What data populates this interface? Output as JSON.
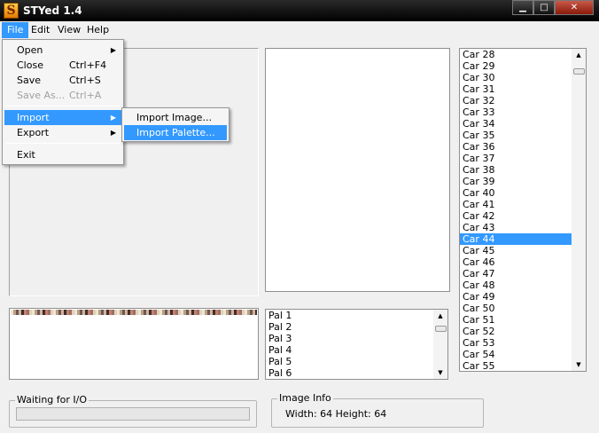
{
  "window": {
    "title": "STYed 1.4",
    "app_icon_letter": "S",
    "min_glyph": "▁",
    "max_glyph": "□",
    "close_glyph": "✕"
  },
  "menubar": [
    "File",
    "Edit",
    "View",
    "Help"
  ],
  "file_menu": {
    "items": [
      {
        "label": "Open",
        "shortcut": "",
        "submenu": true,
        "disabled": false
      },
      {
        "label": "Close",
        "shortcut": "Ctrl+F4",
        "submenu": false,
        "disabled": false
      },
      {
        "label": "Save",
        "shortcut": "Ctrl+S",
        "submenu": false,
        "disabled": false
      },
      {
        "label": "Save As...",
        "shortcut": "Ctrl+A",
        "submenu": false,
        "disabled": true
      },
      {
        "label": "Import",
        "shortcut": "",
        "submenu": true,
        "disabled": false
      },
      {
        "label": "Export",
        "shortcut": "",
        "submenu": true,
        "disabled": false
      },
      {
        "label": "Exit",
        "shortcut": "",
        "submenu": false,
        "disabled": false
      }
    ]
  },
  "import_submenu": [
    "Import Image...",
    "Import Palette..."
  ],
  "palette_list": [
    "Pal 1",
    "Pal 2",
    "Pal 3",
    "Pal 4",
    "Pal 5",
    "Pal 6"
  ],
  "car_list": [
    "Car 28",
    "Car 29",
    "Car 30",
    "Car 31",
    "Car 32",
    "Car 33",
    "Car 34",
    "Car 35",
    "Car 36",
    "Car 37",
    "Car 38",
    "Car 39",
    "Car 40",
    "Car 41",
    "Car 42",
    "Car 43",
    "Car 44",
    "Car 45",
    "Car 46",
    "Car 47",
    "Car 48",
    "Car 49",
    "Car 50",
    "Car 51",
    "Car 52",
    "Car 53",
    "Car 54",
    "Car 55"
  ],
  "car_selected": "Car 44",
  "status": {
    "legend": "Waiting for I/O"
  },
  "image_info": {
    "legend": "Image Info",
    "text": "Width: 64 Height: 64"
  },
  "colors": {
    "selection": "#3399ff",
    "menu_bg": "#f5f5f5"
  }
}
